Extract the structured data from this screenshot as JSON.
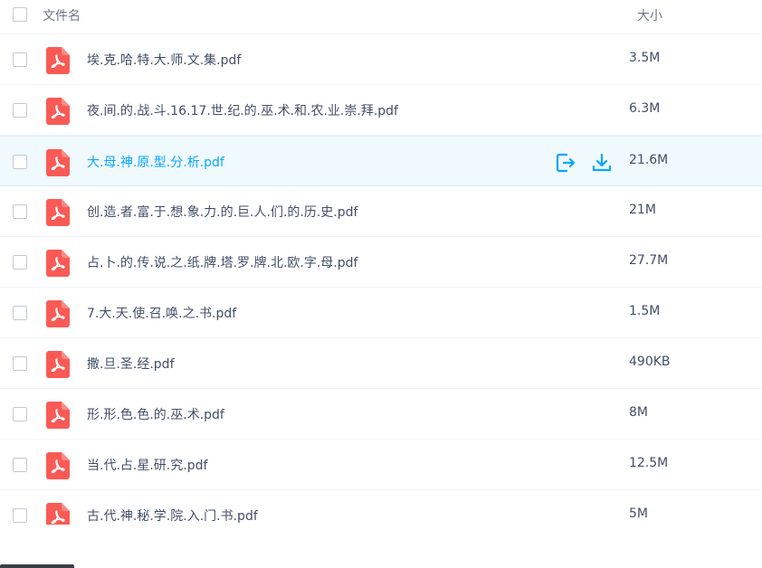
{
  "header": {
    "name_label": "文件名",
    "size_label": "大小"
  },
  "icons": {
    "file_type": "pdf-file-icon",
    "share": "share-icon",
    "download": "download-icon"
  },
  "colors": {
    "pdf_icon": "#fa5a55",
    "accent": "#06a7ff",
    "hover_row": "#f0f9fe"
  },
  "files": [
    {
      "name": "埃.克.哈.特.大.师.文.集.pdf",
      "size": "3.5M"
    },
    {
      "name": "夜.间.的.战.斗.16.17.世.纪.的.巫.术.和.农.业.崇.拜.pdf",
      "size": "6.3M"
    },
    {
      "name": "大.母.神.原.型.分.析.pdf",
      "size": "21.6M"
    },
    {
      "name": "创.造.者.富.于.想.象.力.的.巨.人.们.的.历.史.pdf",
      "size": "21M"
    },
    {
      "name": "占.卜.的.传.说.之.纸.牌.塔.罗.牌.北.欧.字.母.pdf",
      "size": "27.7M"
    },
    {
      "name": "7.大.天.使.召.唤.之.书.pdf",
      "size": "1.5M"
    },
    {
      "name": "撒.旦.圣.经.pdf",
      "size": "490KB"
    },
    {
      "name": "形.形.色.色.的.巫.术.pdf",
      "size": "8M"
    },
    {
      "name": "当.代.占.星.研.究.pdf",
      "size": "12.5M"
    },
    {
      "name": "古.代.神.秘.学.院.入.门.书.pdf",
      "size": "5M"
    }
  ]
}
